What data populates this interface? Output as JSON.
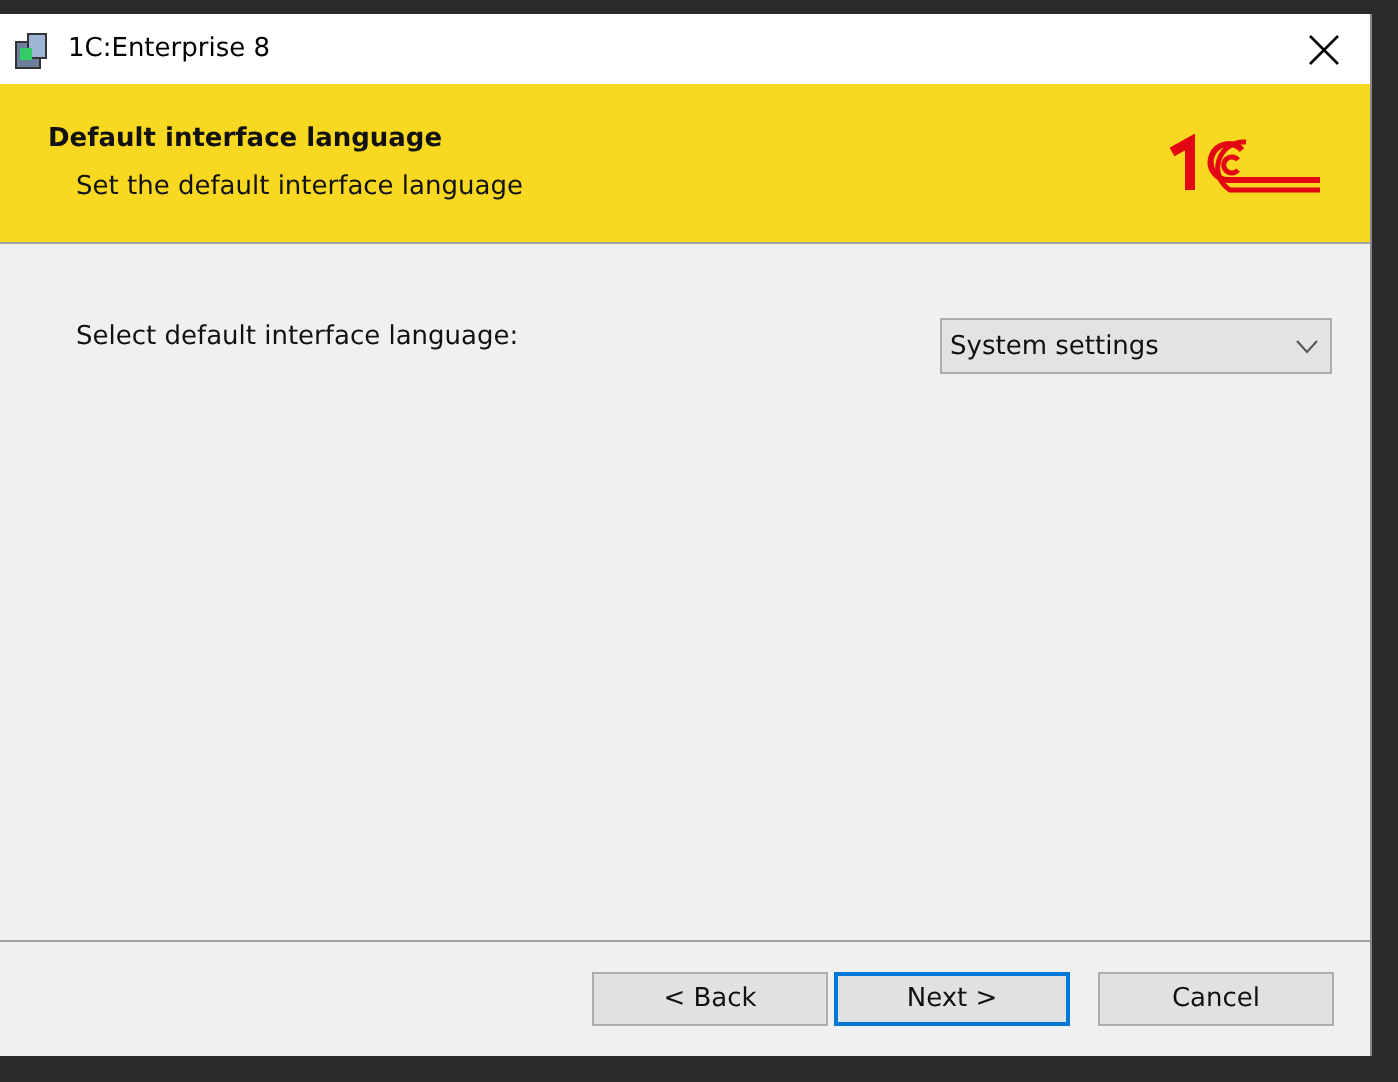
{
  "window": {
    "title": "1C:Enterprise 8"
  },
  "header": {
    "title": "Default interface language",
    "subtitle": "Set the default interface language"
  },
  "form": {
    "label": "Select default interface language:",
    "dropdown": {
      "value": "System settings"
    }
  },
  "buttons": [
    {
      "label": "< Back",
      "focused": false
    },
    {
      "label": "Next >",
      "focused": true
    },
    {
      "label": "Cancel",
      "focused": false
    }
  ]
}
